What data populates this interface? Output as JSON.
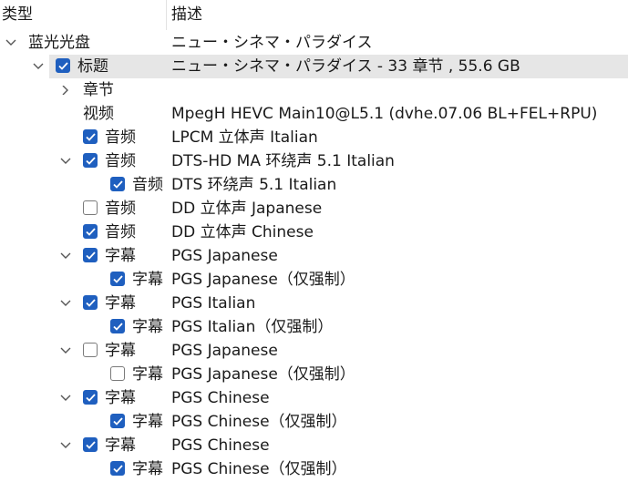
{
  "header": {
    "type_label": "类型",
    "desc_label": "描述"
  },
  "tree": {
    "rows": [
      {
        "level": 0,
        "chevron": "down",
        "checkbox": "none",
        "label": "蓝光光盘",
        "desc": "ニュー・シネマ・パラダイス",
        "selected": false
      },
      {
        "level": 1,
        "chevron": "down",
        "checkbox": "checked",
        "label": "标题",
        "desc": "ニュー・シネマ・パラダイス - 33 章节 , 55.6 GB",
        "selected": true
      },
      {
        "level": 2,
        "chevron": "right",
        "checkbox": "none",
        "label": "章节",
        "desc": "",
        "selected": false
      },
      {
        "level": 2,
        "chevron": "none",
        "checkbox": "none",
        "label": "视频",
        "desc": "MpegH HEVC Main10@L5.1 (dvhe.07.06 BL+FEL+RPU)",
        "selected": false
      },
      {
        "level": 2,
        "chevron": "none",
        "checkbox": "checked",
        "label": "音频",
        "desc": "LPCM 立体声 Italian",
        "selected": false
      },
      {
        "level": 2,
        "chevron": "down",
        "checkbox": "checked",
        "label": "音频",
        "desc": "DTS-HD MA 环绕声 5.1 Italian",
        "selected": false
      },
      {
        "level": 3,
        "chevron": "none",
        "checkbox": "checked",
        "label": "音频",
        "desc": "DTS 环绕声 5.1 Italian",
        "selected": false
      },
      {
        "level": 2,
        "chevron": "none",
        "checkbox": "unchecked",
        "label": "音频",
        "desc": "DD 立体声 Japanese",
        "selected": false
      },
      {
        "level": 2,
        "chevron": "none",
        "checkbox": "checked",
        "label": "音频",
        "desc": "DD 立体声 Chinese",
        "selected": false
      },
      {
        "level": 2,
        "chevron": "down",
        "checkbox": "checked",
        "label": "字幕",
        "desc": "PGS Japanese",
        "selected": false
      },
      {
        "level": 3,
        "chevron": "none",
        "checkbox": "checked",
        "label": "字幕",
        "desc": "PGS Japanese（仅强制）",
        "selected": false
      },
      {
        "level": 2,
        "chevron": "down",
        "checkbox": "checked",
        "label": "字幕",
        "desc": "PGS Italian",
        "selected": false
      },
      {
        "level": 3,
        "chevron": "none",
        "checkbox": "checked",
        "label": "字幕",
        "desc": "PGS Italian（仅强制）",
        "selected": false
      },
      {
        "level": 2,
        "chevron": "down",
        "checkbox": "unchecked",
        "label": "字幕",
        "desc": "PGS Japanese",
        "selected": false
      },
      {
        "level": 3,
        "chevron": "none",
        "checkbox": "unchecked",
        "label": "字幕",
        "desc": "PGS Japanese（仅强制）",
        "selected": false
      },
      {
        "level": 2,
        "chevron": "down",
        "checkbox": "checked",
        "label": "字幕",
        "desc": "PGS Chinese",
        "selected": false
      },
      {
        "level": 3,
        "chevron": "none",
        "checkbox": "checked",
        "label": "字幕",
        "desc": "PGS Chinese（仅强制）",
        "selected": false
      },
      {
        "level": 2,
        "chevron": "down",
        "checkbox": "checked",
        "label": "字幕",
        "desc": "PGS Chinese",
        "selected": false
      },
      {
        "level": 3,
        "chevron": "none",
        "checkbox": "checked",
        "label": "字幕",
        "desc": "PGS Chinese（仅强制）",
        "selected": false
      }
    ]
  },
  "colors": {
    "accent": "#1f5fbf",
    "selection": "#e6e6e6",
    "text": "#1a1a1a"
  },
  "icons": {
    "expanded": "chevron-down-icon",
    "collapsed": "chevron-right-icon",
    "check": "check-icon"
  }
}
